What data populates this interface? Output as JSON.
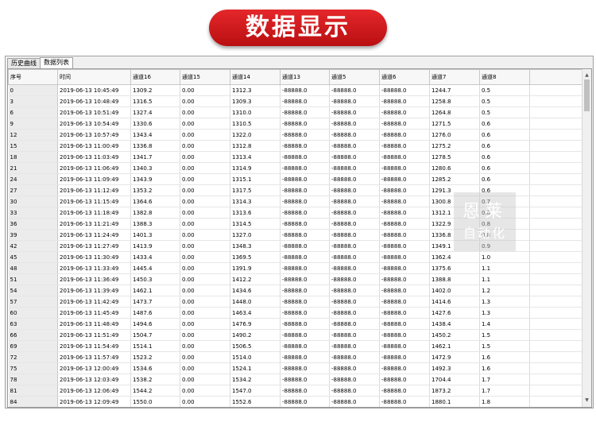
{
  "banner_title": "数据显示",
  "tabs": [
    {
      "label": "历史曲线",
      "active": false
    },
    {
      "label": "数据列表",
      "active": true
    }
  ],
  "table": {
    "columns": [
      "序号",
      "时间",
      "通道16",
      "通道15",
      "通道14",
      "通道13",
      "通道5",
      "通道6",
      "通道7",
      "通道8",
      ""
    ],
    "rows": [
      [
        "0",
        "2019-06-13 10:45:49",
        "1309.2",
        "0.00",
        "1312.3",
        "-88888.0",
        "-88888.0",
        "-88888.0",
        "1244.7",
        "0.5"
      ],
      [
        "3",
        "2019-06-13 10:48:49",
        "1316.5",
        "0.00",
        "1309.3",
        "-88888.0",
        "-88888.0",
        "-88888.0",
        "1258.8",
        "0.5"
      ],
      [
        "6",
        "2019-06-13 10:51:49",
        "1327.4",
        "0.00",
        "1310.0",
        "-88888.0",
        "-88888.0",
        "-88888.0",
        "1264.8",
        "0.5"
      ],
      [
        "9",
        "2019-06-13 10:54:49",
        "1330.6",
        "0.00",
        "1310.5",
        "-88888.0",
        "-88888.0",
        "-88888.0",
        "1271.5",
        "0.6"
      ],
      [
        "12",
        "2019-06-13 10:57:49",
        "1343.4",
        "0.00",
        "1322.0",
        "-88888.0",
        "-88888.0",
        "-88888.0",
        "1276.0",
        "0.6"
      ],
      [
        "15",
        "2019-06-13 11:00:49",
        "1336.8",
        "0.00",
        "1312.8",
        "-88888.0",
        "-88888.0",
        "-88888.0",
        "1275.2",
        "0.6"
      ],
      [
        "18",
        "2019-06-13 11:03:49",
        "1341.7",
        "0.00",
        "1313.4",
        "-88888.0",
        "-88888.0",
        "-88888.0",
        "1278.5",
        "0.6"
      ],
      [
        "21",
        "2019-06-13 11:06:49",
        "1340.3",
        "0.00",
        "1314.9",
        "-88888.0",
        "-88888.0",
        "-88888.0",
        "1280.6",
        "0.6"
      ],
      [
        "24",
        "2019-06-13 11:09:49",
        "1343.9",
        "0.00",
        "1315.1",
        "-88888.0",
        "-88888.0",
        "-88888.0",
        "1285.2",
        "0.6"
      ],
      [
        "27",
        "2019-06-13 11:12:49",
        "1353.2",
        "0.00",
        "1317.5",
        "-88888.0",
        "-88888.0",
        "-88888.0",
        "1291.3",
        "0.6"
      ],
      [
        "30",
        "2019-06-13 11:15:49",
        "1364.6",
        "0.00",
        "1314.3",
        "-88888.0",
        "-88888.0",
        "-88888.0",
        "1300.8",
        "0.7"
      ],
      [
        "33",
        "2019-06-13 11:18:49",
        "1382.8",
        "0.00",
        "1313.6",
        "-88888.0",
        "-88888.0",
        "-88888.0",
        "1312.1",
        "0.8"
      ],
      [
        "36",
        "2019-06-13 11:21:49",
        "1388.3",
        "0.00",
        "1314.5",
        "-88888.0",
        "-88888.0",
        "-88888.0",
        "1322.9",
        "0.8"
      ],
      [
        "39",
        "2019-06-13 11:24:49",
        "1401.3",
        "0.00",
        "1327.0",
        "-88888.0",
        "-88888.0",
        "-88888.0",
        "1336.8",
        "0.8"
      ],
      [
        "42",
        "2019-06-13 11:27:49",
        "1413.9",
        "0.00",
        "1348.3",
        "-88888.0",
        "-88888.0",
        "-88888.0",
        "1349.1",
        "0.9"
      ],
      [
        "45",
        "2019-06-13 11:30:49",
        "1433.4",
        "0.00",
        "1369.5",
        "-88888.0",
        "-88888.0",
        "-88888.0",
        "1362.4",
        "1.0"
      ],
      [
        "48",
        "2019-06-13 11:33:49",
        "1445.4",
        "0.00",
        "1391.9",
        "-88888.0",
        "-88888.0",
        "-88888.0",
        "1375.6",
        "1.1"
      ],
      [
        "51",
        "2019-06-13 11:36:49",
        "1450.3",
        "0.00",
        "1412.2",
        "-88888.0",
        "-88888.0",
        "-88888.0",
        "1388.8",
        "1.1"
      ],
      [
        "54",
        "2019-06-13 11:39:49",
        "1462.1",
        "0.00",
        "1434.6",
        "-88888.0",
        "-88888.0",
        "-88888.0",
        "1402.0",
        "1.2"
      ],
      [
        "57",
        "2019-06-13 11:42:49",
        "1473.7",
        "0.00",
        "1448.0",
        "-88888.0",
        "-88888.0",
        "-88888.0",
        "1414.6",
        "1.3"
      ],
      [
        "60",
        "2019-06-13 11:45:49",
        "1487.6",
        "0.00",
        "1463.4",
        "-88888.0",
        "-88888.0",
        "-88888.0",
        "1427.6",
        "1.3"
      ],
      [
        "63",
        "2019-06-13 11:48:49",
        "1494.6",
        "0.00",
        "1476.9",
        "-88888.0",
        "-88888.0",
        "-88888.0",
        "1438.4",
        "1.4"
      ],
      [
        "66",
        "2019-06-13 11:51:49",
        "1504.7",
        "0.00",
        "1490.2",
        "-88888.0",
        "-88888.0",
        "-88888.0",
        "1450.2",
        "1.5"
      ],
      [
        "69",
        "2019-06-13 11:54:49",
        "1514.1",
        "0.00",
        "1506.5",
        "-88888.0",
        "-88888.0",
        "-88888.0",
        "1462.1",
        "1.5"
      ],
      [
        "72",
        "2019-06-13 11:57:49",
        "1523.2",
        "0.00",
        "1514.0",
        "-88888.0",
        "-88888.0",
        "-88888.0",
        "1472.9",
        "1.6"
      ],
      [
        "75",
        "2019-06-13 12:00:49",
        "1534.6",
        "0.00",
        "1524.1",
        "-88888.0",
        "-88888.0",
        "-88888.0",
        "1492.3",
        "1.6"
      ],
      [
        "78",
        "2019-06-13 12:03:49",
        "1538.2",
        "0.00",
        "1534.2",
        "-88888.0",
        "-88888.0",
        "-88888.0",
        "1704.4",
        "1.7"
      ],
      [
        "81",
        "2019-06-13 12:06:49",
        "1544.2",
        "0.00",
        "1547.0",
        "-88888.0",
        "-88888.0",
        "-88888.0",
        "1873.2",
        "1.7"
      ],
      [
        "84",
        "2019-06-13 12:09:49",
        "1550.0",
        "0.00",
        "1552.6",
        "-88888.0",
        "-88888.0",
        "-88888.0",
        "1880.1",
        "1.8"
      ]
    ]
  },
  "watermark": {
    "line1": "恩莱",
    "line2": "自动化"
  },
  "icons": {
    "scroll_up": "scroll-up-arrow-icon",
    "scroll_down": "scroll-down-arrow-icon"
  },
  "colors": {
    "banner": "#d41e21"
  }
}
